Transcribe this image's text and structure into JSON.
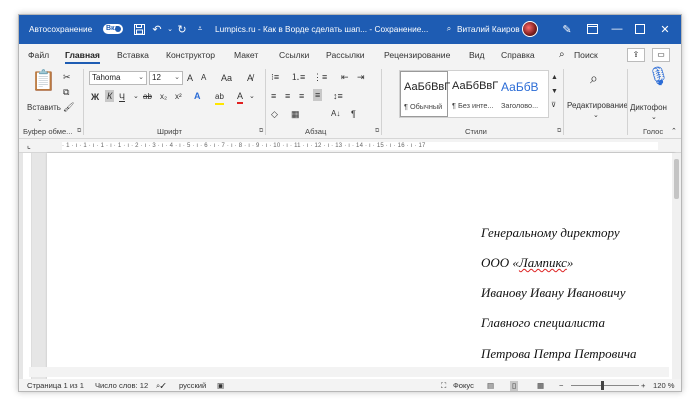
{
  "titlebar": {
    "autosave_label": "Автосохранение",
    "autosave_state": "Вкл",
    "doc_title": "Lumpics.ru - Как в Ворде сделать шап... - Сохранение...",
    "user_name": "Виталий Каиров",
    "icons": [
      "save-icon",
      "undo-icon",
      "redo-icon",
      "customize-icon",
      "pen-icon",
      "restore-icon",
      "minimize-icon",
      "maximize-icon",
      "close-icon"
    ]
  },
  "menu": {
    "tabs": [
      "Файл",
      "Главная",
      "Вставка",
      "Конструктор",
      "Макет",
      "Ссылки",
      "Рассылки",
      "Рецензирование",
      "Вид",
      "Справка"
    ],
    "active_tab": "Главная",
    "search_label": "Поиск"
  },
  "ribbon": {
    "clipboard": {
      "paste_label": "Вставить",
      "group_label": "Буфер обме..."
    },
    "font": {
      "font_name": "Tahoma",
      "font_size": "12",
      "grow": "A",
      "shrink": "A",
      "case": "Aa",
      "bold": "Ж",
      "italic": "К",
      "underline": "Ч",
      "strike": "ab",
      "subscript": "x₂",
      "superscript": "x²",
      "effects": "A",
      "highlight": "ab",
      "color": "A",
      "group_label": "Шрифт"
    },
    "paragraph": {
      "group_label": "Абзац",
      "sort": "А↓",
      "pilcrow": "¶"
    },
    "styles": {
      "items": [
        {
          "preview": "АаБбВвГ",
          "name": "¶ Обычный"
        },
        {
          "preview": "АаБбВвГ",
          "name": "¶ Без инте..."
        },
        {
          "preview": "АаБбВ",
          "name": "Заголово..."
        }
      ],
      "group_label": "Стили"
    },
    "editing": {
      "label": "Редактирование"
    },
    "voice": {
      "dictate_label": "Диктофон",
      "group_label": "Голос"
    }
  },
  "ruler": {
    "text": "· 1 · ı · 1 · ı · 1 · ı · 1 · ı · 2 · ı · 3 · ı · 4 · ı · 5 · ı · 6 · ı · 7 · ı · 8 · ı · 9 · ı · 10 · ı · 11 · ı · 12 · ı · 13 · ı · 14 · ı · 15 · ı · 16 · ı · 17"
  },
  "document": {
    "lines": [
      "Генеральному директору",
      "ООО «Лампикс»",
      "Иванову Ивану Ивановичу",
      "Главного специалиста",
      "Петрова Петра Петровича"
    ],
    "misspelled": "Лампикс"
  },
  "statusbar": {
    "page": "Страница 1 из 1",
    "words": "Число слов: 12",
    "language": "русский",
    "focus": "Фокус",
    "zoom": "120 %",
    "zoom_minus": "−",
    "zoom_plus": "+"
  }
}
